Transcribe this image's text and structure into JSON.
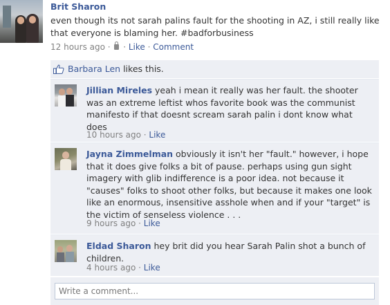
{
  "post": {
    "author": "Brit Sharon",
    "text": "even though its not sarah palins fault for the shooting in AZ, i still really like that everyone is blaming her. #badforbusiness",
    "time": "12 hours ago",
    "sep1": " · ",
    "sep2": " · ",
    "like": "Like",
    "sep3": " · ",
    "comment": "Comment",
    "privacy_icon": "lock-icon"
  },
  "likes": {
    "name": "Barbara Len",
    "suffix": " likes this.",
    "icon": "thumbs-up-icon"
  },
  "comments": [
    {
      "author": "Jillian Mireles",
      "text": " yeah i mean it really was her fault. the shooter was an extreme leftist whos favorite book was the communist manifesto if that doesnt scream sarah palin i dont know what does",
      "time": "10 hours ago",
      "sep": " · ",
      "like": "Like"
    },
    {
      "author": "Jayna Zimmelman",
      "text": " obviously it isn't her \"fault.\" however, i hope that it does give folks a bit of pause. perhaps using gun sight imagery with glib indifference is a poor idea. not because it \"causes\" folks to shoot other folks, but because it makes one look like an enormous, insensitive asshole when and if your \"target\" is the victim of senseless violence . . .",
      "time": "9 hours ago",
      "sep": " · ",
      "like": "Like"
    },
    {
      "author": "Eldad Sharon",
      "text": " hey brit did you hear Sarah Palin shot a bunch of children.",
      "time": "4 hours ago",
      "sep": " · ",
      "like": "Like"
    }
  ],
  "composer": {
    "placeholder": "Write a comment..."
  },
  "colors": {
    "link": "#3b5998",
    "panel": "#edeff4",
    "meta": "#808080"
  }
}
